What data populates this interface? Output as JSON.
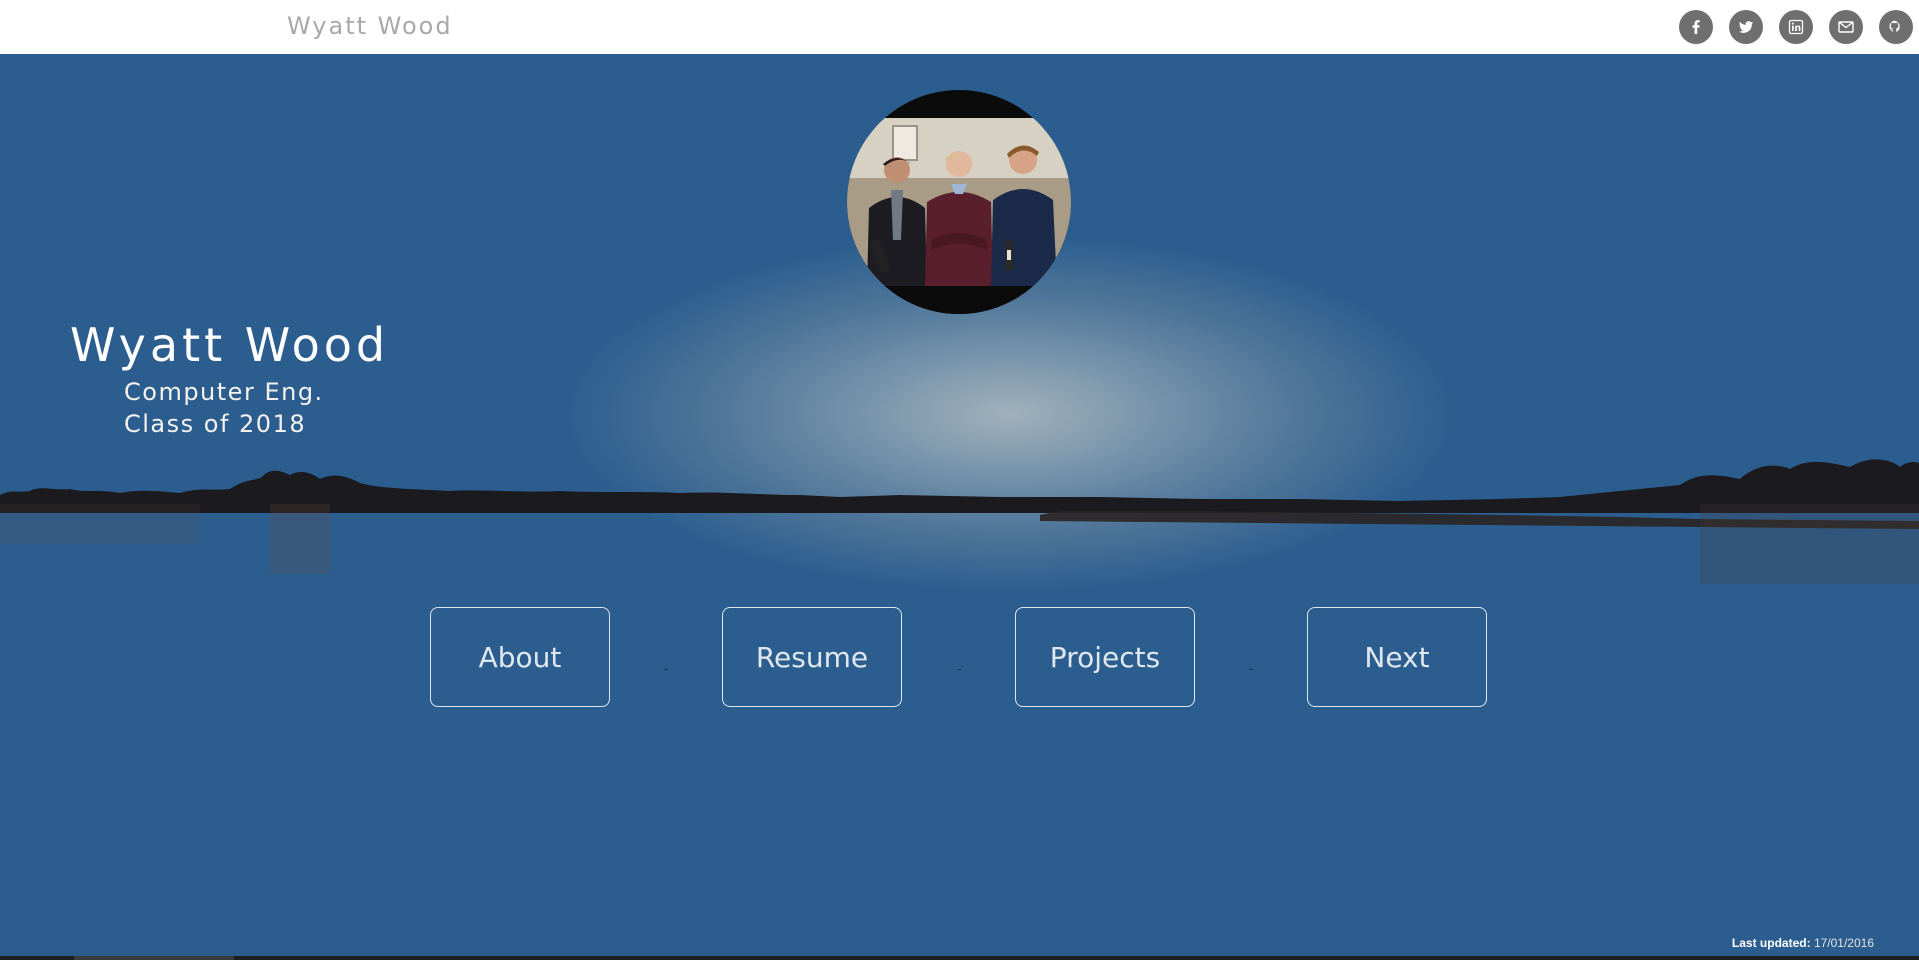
{
  "header": {
    "brand": "Wyatt Wood",
    "social": [
      {
        "name": "facebook",
        "icon": "facebook-icon"
      },
      {
        "name": "twitter",
        "icon": "twitter-icon"
      },
      {
        "name": "linkedin",
        "icon": "linkedin-icon"
      },
      {
        "name": "email",
        "icon": "mail-icon"
      },
      {
        "name": "github",
        "icon": "github-icon"
      }
    ]
  },
  "hero": {
    "name": "Wyatt Wood",
    "subtitle_line1": "Computer Eng.",
    "subtitle_line2": "Class of 2018",
    "avatar": "profile-photo"
  },
  "nav": {
    "about": "About",
    "resume": "Resume",
    "projects": "Projects",
    "next": "Next"
  },
  "footer": {
    "label": "Last updated:",
    "date": "17/01/2016"
  },
  "colors": {
    "topbar": "#ffffff",
    "brand": "#a9a9a9",
    "social_icon_bg": "#6f6f6f",
    "sky_top": "#1e5a8e",
    "horizon": "#f19a43",
    "water_bottom": "#224f7d"
  }
}
